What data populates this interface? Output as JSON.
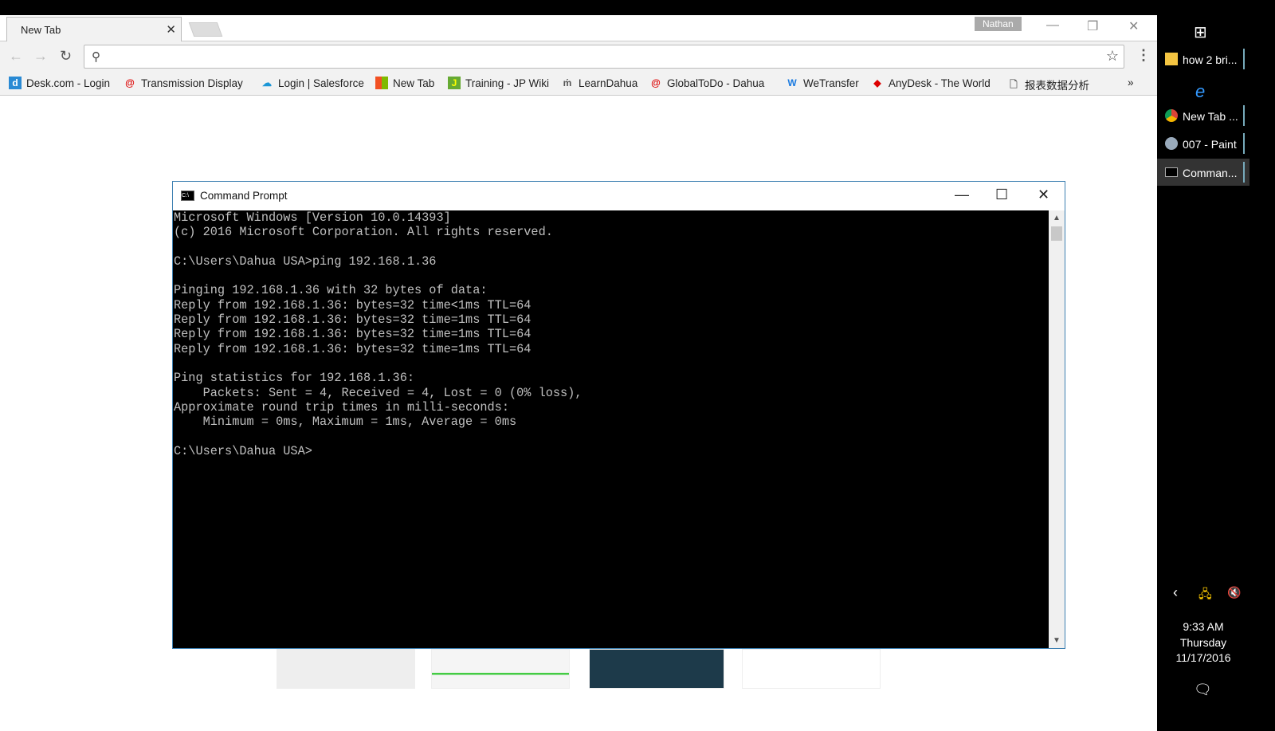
{
  "browser": {
    "tab_title": "New Tab",
    "profile": "Nathan",
    "omnibox_value": "",
    "bookmarks": [
      {
        "label": "Desk.com - Login",
        "icon": "desk-icon",
        "color": "#2a8ad4"
      },
      {
        "label": "Transmission Display",
        "icon": "dahua-icon",
        "color": "#d00"
      },
      {
        "label": "Login | Salesforce",
        "icon": "salesforce-icon",
        "color": "#1b96d6"
      },
      {
        "label": "New Tab",
        "icon": "windows-icon",
        "color": "#f25022"
      },
      {
        "label": "Training - JP Wiki",
        "icon": "wiki-icon",
        "color": "#6a3"
      },
      {
        "label": "LearnDahua",
        "icon": "learndahua-icon",
        "color": "#555"
      },
      {
        "label": "GlobalToDo - Dahua",
        "icon": "dahua-icon",
        "color": "#d00"
      },
      {
        "label": "WeTransfer",
        "icon": "wetransfer-icon",
        "color": "#1a7ae0"
      },
      {
        "label": "AnyDesk - The World",
        "icon": "anydesk-icon",
        "color": "#d00"
      },
      {
        "label": "报表数据分析",
        "icon": "page-icon",
        "color": "#666"
      }
    ],
    "more": "»"
  },
  "cmd": {
    "title": "Command Prompt",
    "lines": [
      "Microsoft Windows [Version 10.0.14393]",
      "(c) 2016 Microsoft Corporation. All rights reserved.",
      "",
      "C:\\Users\\Dahua USA>ping 192.168.1.36",
      "",
      "Pinging 192.168.1.36 with 32 bytes of data:",
      "Reply from 192.168.1.36: bytes=32 time<1ms TTL=64",
      "Reply from 192.168.1.36: bytes=32 time=1ms TTL=64",
      "Reply from 192.168.1.36: bytes=32 time=1ms TTL=64",
      "Reply from 192.168.1.36: bytes=32 time=1ms TTL=64",
      "",
      "Ping statistics for 192.168.1.36:",
      "    Packets: Sent = 4, Received = 4, Lost = 0 (0% loss),",
      "Approximate round trip times in milli-seconds:",
      "    Minimum = 0ms, Maximum = 1ms, Average = 0ms",
      "",
      "C:\\Users\\Dahua USA>"
    ]
  },
  "taskbar": {
    "items": [
      {
        "label": "how 2 bri...",
        "icon": "folder-icon"
      },
      {
        "label": "",
        "icon": "ie-icon"
      },
      {
        "label": "New Tab ...",
        "icon": "chrome-icon"
      },
      {
        "label": "007 - Paint",
        "icon": "paint-icon"
      },
      {
        "label": "Comman...",
        "icon": "cmd-icon",
        "active": true
      }
    ],
    "time": "9:33 AM",
    "day": "Thursday",
    "date": "11/17/2016"
  }
}
